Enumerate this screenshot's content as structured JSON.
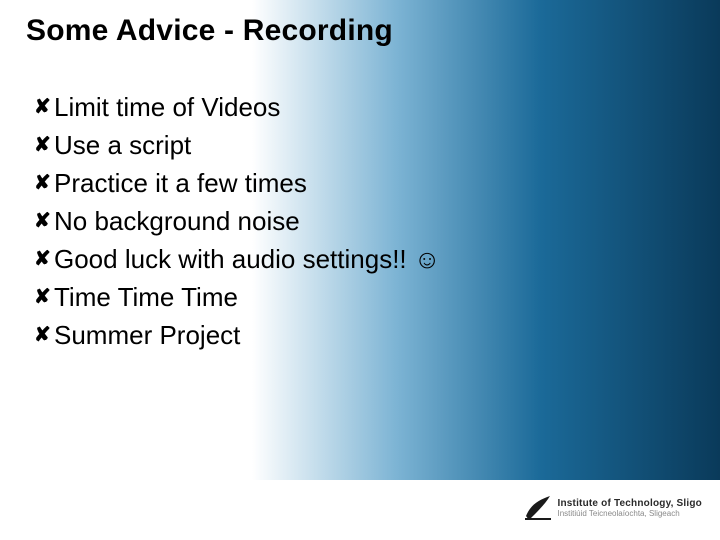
{
  "slide": {
    "title": "Some Advice - Recording",
    "bullets": [
      "Limit time of Videos",
      "Use a script",
      "Practice it a few times",
      "No background noise",
      "Good luck with audio settings!! ☺",
      "Time Time Time",
      "Summer Project"
    ]
  },
  "footer": {
    "org_line1": "Institute of Technology, Sligo",
    "org_line2": "Institiúid Teicneolaíochta, Sligeach"
  }
}
